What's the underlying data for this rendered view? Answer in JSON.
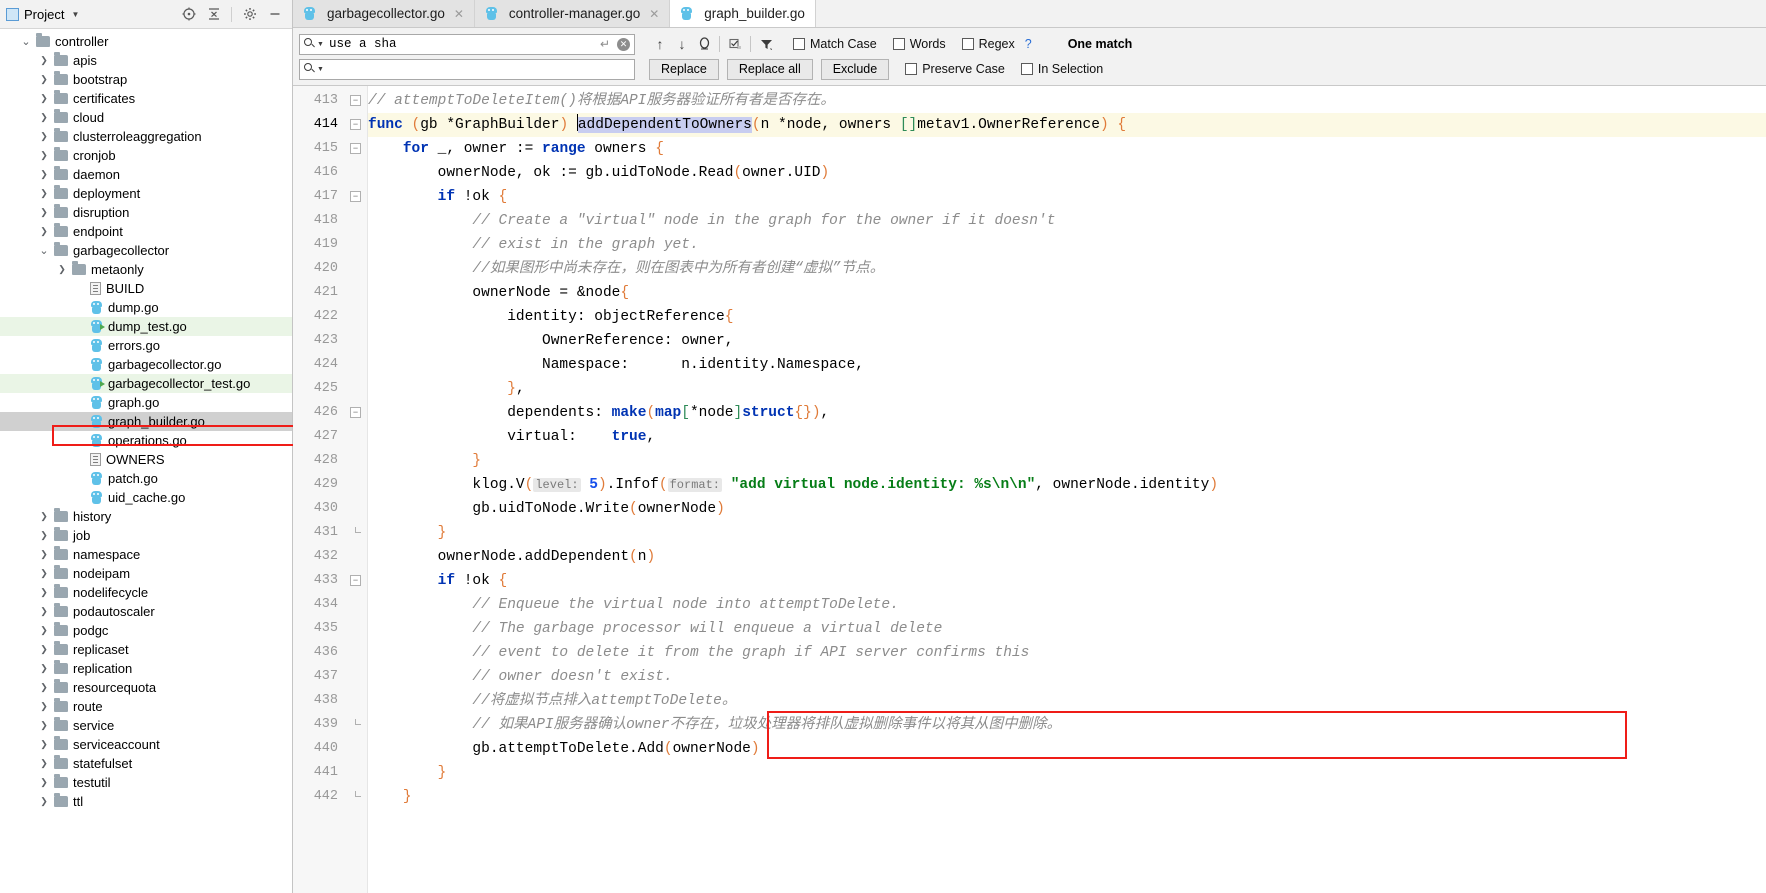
{
  "sidebar": {
    "title": "Project",
    "icons": [
      "target-icon",
      "collapse-all-icon",
      "gear-icon",
      "minimize-icon"
    ],
    "items": [
      {
        "label": "controller",
        "type": "folder",
        "depth": 1,
        "state": "expanded"
      },
      {
        "label": "apis",
        "type": "folder",
        "depth": 2,
        "state": "collapsed"
      },
      {
        "label": "bootstrap",
        "type": "folder",
        "depth": 2,
        "state": "collapsed"
      },
      {
        "label": "certificates",
        "type": "folder",
        "depth": 2,
        "state": "collapsed"
      },
      {
        "label": "cloud",
        "type": "folder",
        "depth": 2,
        "state": "collapsed"
      },
      {
        "label": "clusterroleaggregation",
        "type": "folder",
        "depth": 2,
        "state": "collapsed"
      },
      {
        "label": "cronjob",
        "type": "folder",
        "depth": 2,
        "state": "collapsed"
      },
      {
        "label": "daemon",
        "type": "folder",
        "depth": 2,
        "state": "collapsed"
      },
      {
        "label": "deployment",
        "type": "folder",
        "depth": 2,
        "state": "collapsed"
      },
      {
        "label": "disruption",
        "type": "folder",
        "depth": 2,
        "state": "collapsed"
      },
      {
        "label": "endpoint",
        "type": "folder",
        "depth": 2,
        "state": "collapsed"
      },
      {
        "label": "garbagecollector",
        "type": "folder",
        "depth": 2,
        "state": "expanded"
      },
      {
        "label": "metaonly",
        "type": "folder",
        "depth": 3,
        "state": "collapsed"
      },
      {
        "label": "BUILD",
        "type": "doc",
        "depth": 4,
        "state": "none"
      },
      {
        "label": "dump.go",
        "type": "go",
        "depth": 4,
        "state": "none"
      },
      {
        "label": "dump_test.go",
        "type": "gotest",
        "depth": 4,
        "state": "none",
        "highlight": "green"
      },
      {
        "label": "errors.go",
        "type": "go",
        "depth": 4,
        "state": "none"
      },
      {
        "label": "garbagecollector.go",
        "type": "go",
        "depth": 4,
        "state": "none"
      },
      {
        "label": "garbagecollector_test.go",
        "type": "gotest",
        "depth": 4,
        "state": "none",
        "highlight": "green"
      },
      {
        "label": "graph.go",
        "type": "go",
        "depth": 4,
        "state": "none"
      },
      {
        "label": "graph_builder.go",
        "type": "go",
        "depth": 4,
        "state": "none",
        "highlight": "selected",
        "boxed": true
      },
      {
        "label": "operations.go",
        "type": "go",
        "depth": 4,
        "state": "none"
      },
      {
        "label": "OWNERS",
        "type": "doc",
        "depth": 4,
        "state": "none"
      },
      {
        "label": "patch.go",
        "type": "go",
        "depth": 4,
        "state": "none"
      },
      {
        "label": "uid_cache.go",
        "type": "go",
        "depth": 4,
        "state": "none"
      },
      {
        "label": "history",
        "type": "folder",
        "depth": 2,
        "state": "collapsed"
      },
      {
        "label": "job",
        "type": "folder",
        "depth": 2,
        "state": "collapsed"
      },
      {
        "label": "namespace",
        "type": "folder",
        "depth": 2,
        "state": "collapsed"
      },
      {
        "label": "nodeipam",
        "type": "folder",
        "depth": 2,
        "state": "collapsed"
      },
      {
        "label": "nodelifecycle",
        "type": "folder",
        "depth": 2,
        "state": "collapsed"
      },
      {
        "label": "podautoscaler",
        "type": "folder",
        "depth": 2,
        "state": "collapsed"
      },
      {
        "label": "podgc",
        "type": "folder",
        "depth": 2,
        "state": "collapsed"
      },
      {
        "label": "replicaset",
        "type": "folder",
        "depth": 2,
        "state": "collapsed"
      },
      {
        "label": "replication",
        "type": "folder",
        "depth": 2,
        "state": "collapsed"
      },
      {
        "label": "resourcequota",
        "type": "folder",
        "depth": 2,
        "state": "collapsed"
      },
      {
        "label": "route",
        "type": "folder",
        "depth": 2,
        "state": "collapsed"
      },
      {
        "label": "service",
        "type": "folder",
        "depth": 2,
        "state": "collapsed"
      },
      {
        "label": "serviceaccount",
        "type": "folder",
        "depth": 2,
        "state": "collapsed"
      },
      {
        "label": "statefulset",
        "type": "folder",
        "depth": 2,
        "state": "collapsed"
      },
      {
        "label": "testutil",
        "type": "folder",
        "depth": 2,
        "state": "collapsed"
      },
      {
        "label": "ttl",
        "type": "folder",
        "depth": 2,
        "state": "collapsed"
      }
    ]
  },
  "tabs": [
    {
      "label": "garbagecollector.go",
      "active": false,
      "closable": true
    },
    {
      "label": "controller-manager.go",
      "active": false,
      "closable": true
    },
    {
      "label": "graph_builder.go",
      "active": true,
      "closable": false
    }
  ],
  "find": {
    "search_value": "use a sha",
    "search_placeholder": "",
    "replace_value": "",
    "replace_placeholder": "",
    "buttons": {
      "replace": "Replace",
      "replace_all": "Replace all",
      "exclude": "Exclude"
    },
    "nav_icons": [
      "find-previous-icon",
      "find-next-icon",
      "select-all-occurrences-icon",
      "filter-icon",
      "toggle-icon"
    ],
    "options": [
      {
        "label": "Match Case",
        "checked": false,
        "accel": "C"
      },
      {
        "label": "Words",
        "checked": false,
        "accel": "o"
      },
      {
        "label": "Regex",
        "checked": false,
        "accel": "x"
      },
      {
        "label": "Preserve Case",
        "checked": false,
        "accel": "e"
      },
      {
        "label": "In Selection",
        "checked": false,
        "accel": "S"
      }
    ],
    "help_glyph": "?",
    "status": "One match"
  },
  "editor": {
    "first_line": 413,
    "current_line": 414,
    "caret_symbol": "|",
    "selection_text": "addDependentToOwners",
    "lines": [
      {
        "n": 413,
        "fold": "open",
        "text": "// attemptToDeleteItem()将根据API服务器验证所有者是否存在。"
      },
      {
        "n": 414,
        "fold": "open",
        "text": "func (gb *GraphBuilder) addDependentToOwners(n *node, owners []metav1.OwnerReference) {"
      },
      {
        "n": 415,
        "fold": "open",
        "text": "    for _, owner := range owners {"
      },
      {
        "n": 416,
        "fold": "none",
        "text": "        ownerNode, ok := gb.uidToNode.Read(owner.UID)"
      },
      {
        "n": 417,
        "fold": "open",
        "text": "        if !ok {"
      },
      {
        "n": 418,
        "fold": "none",
        "text": "            // Create a \"virtual\" node in the graph for the owner if it doesn't"
      },
      {
        "n": 419,
        "fold": "none",
        "text": "            // exist in the graph yet."
      },
      {
        "n": 420,
        "fold": "none",
        "text": "            //如果图形中尚未存在，则在图表中为所有者创建“虚拟”节点。"
      },
      {
        "n": 421,
        "fold": "none",
        "text": "            ownerNode = &node{"
      },
      {
        "n": 422,
        "fold": "none",
        "text": "                identity: objectReference{"
      },
      {
        "n": 423,
        "fold": "none",
        "text": "                    OwnerReference: owner,"
      },
      {
        "n": 424,
        "fold": "none",
        "text": "                    Namespace:      n.identity.Namespace,"
      },
      {
        "n": 425,
        "fold": "none",
        "text": "                },"
      },
      {
        "n": 426,
        "fold": "open",
        "text": "                dependents: make(map[*node]struct{}),"
      },
      {
        "n": 427,
        "fold": "none",
        "text": "                virtual:    true,"
      },
      {
        "n": 428,
        "fold": "none",
        "text": "            }"
      },
      {
        "n": 429,
        "fold": "none",
        "text": "            klog.V( level: 5).Infof( format: \"add virtual node.identity: %s\\n\\n\", ownerNode.identity)"
      },
      {
        "n": 430,
        "fold": "none",
        "text": "            gb.uidToNode.Write(ownerNode)"
      },
      {
        "n": 431,
        "fold": "end",
        "text": "        }"
      },
      {
        "n": 432,
        "fold": "none",
        "text": "        ownerNode.addDependent(n)"
      },
      {
        "n": 433,
        "fold": "open",
        "text": "        if !ok {"
      },
      {
        "n": 434,
        "fold": "none",
        "text": "            // Enqueue the virtual node into attemptToDelete."
      },
      {
        "n": 435,
        "fold": "none",
        "text": "            // The garbage processor will enqueue a virtual delete"
      },
      {
        "n": 436,
        "fold": "none",
        "text": "            // event to delete it from the graph if API server confirms this"
      },
      {
        "n": 437,
        "fold": "none",
        "text": "            // owner doesn't exist."
      },
      {
        "n": 438,
        "fold": "none",
        "text": "            //将虚拟节点排入attemptToDelete。"
      },
      {
        "n": 439,
        "fold": "end",
        "text": "            // 如果API服务器确认owner不存在，垃圾处理器将排队虚拟删除事件以将其从图中删除。"
      },
      {
        "n": 440,
        "fold": "none",
        "text": "            gb.attemptToDelete.Add(ownerNode)"
      },
      {
        "n": 441,
        "fold": "none",
        "text": "        }"
      },
      {
        "n": 442,
        "fold": "end",
        "text": "    }"
      }
    ]
  },
  "annotations": {
    "box_color": "#ef1d18",
    "sidebar_box_target": "graph_builder.go",
    "code_box_lines": [
      439,
      440
    ]
  }
}
